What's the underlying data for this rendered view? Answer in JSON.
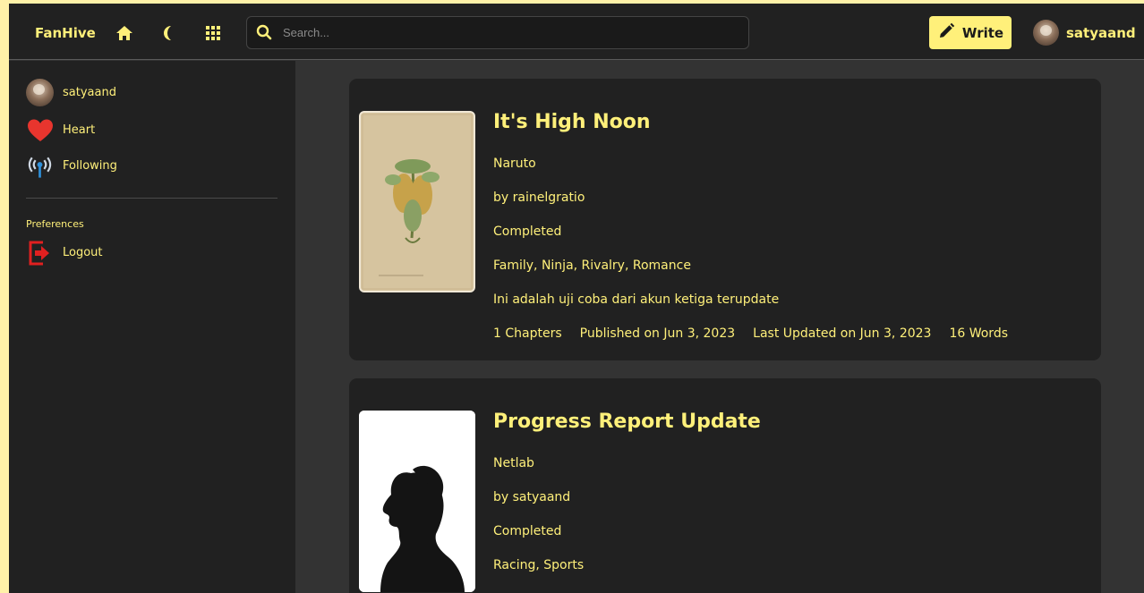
{
  "header": {
    "brand": "FanHive",
    "search_placeholder": "Search...",
    "write_label": "Write",
    "username": "satyaand"
  },
  "sidebar": {
    "items": [
      {
        "label": "satyaand",
        "icon": "avatar"
      },
      {
        "label": "Heart",
        "icon": "heart-icon"
      },
      {
        "label": "Following",
        "icon": "broadcast-icon"
      }
    ],
    "section_label": "Preferences",
    "logout_label": "Logout"
  },
  "stories": [
    {
      "title": "It's High Noon",
      "fandom": "Naruto",
      "author": "by rainelgratio",
      "status": "Completed",
      "tags": "Family, Ninja, Rivalry, Romance",
      "summary": "Ini adalah uji coba dari akun ketiga terupdate",
      "chapters": "1 Chapters",
      "published": "Published on Jun 3, 2023",
      "updated": "Last Updated on Jun 3, 2023",
      "words": "16 Words"
    },
    {
      "title": "Progress Report Update",
      "fandom": "Netlab",
      "author": "by satyaand",
      "status": "Completed",
      "tags": "Racing, Sports"
    }
  ],
  "colors": {
    "accent": "#fff07a",
    "panel": "#212121",
    "background": "#333333",
    "heart": "#e8352e",
    "logout": "#e02020"
  }
}
